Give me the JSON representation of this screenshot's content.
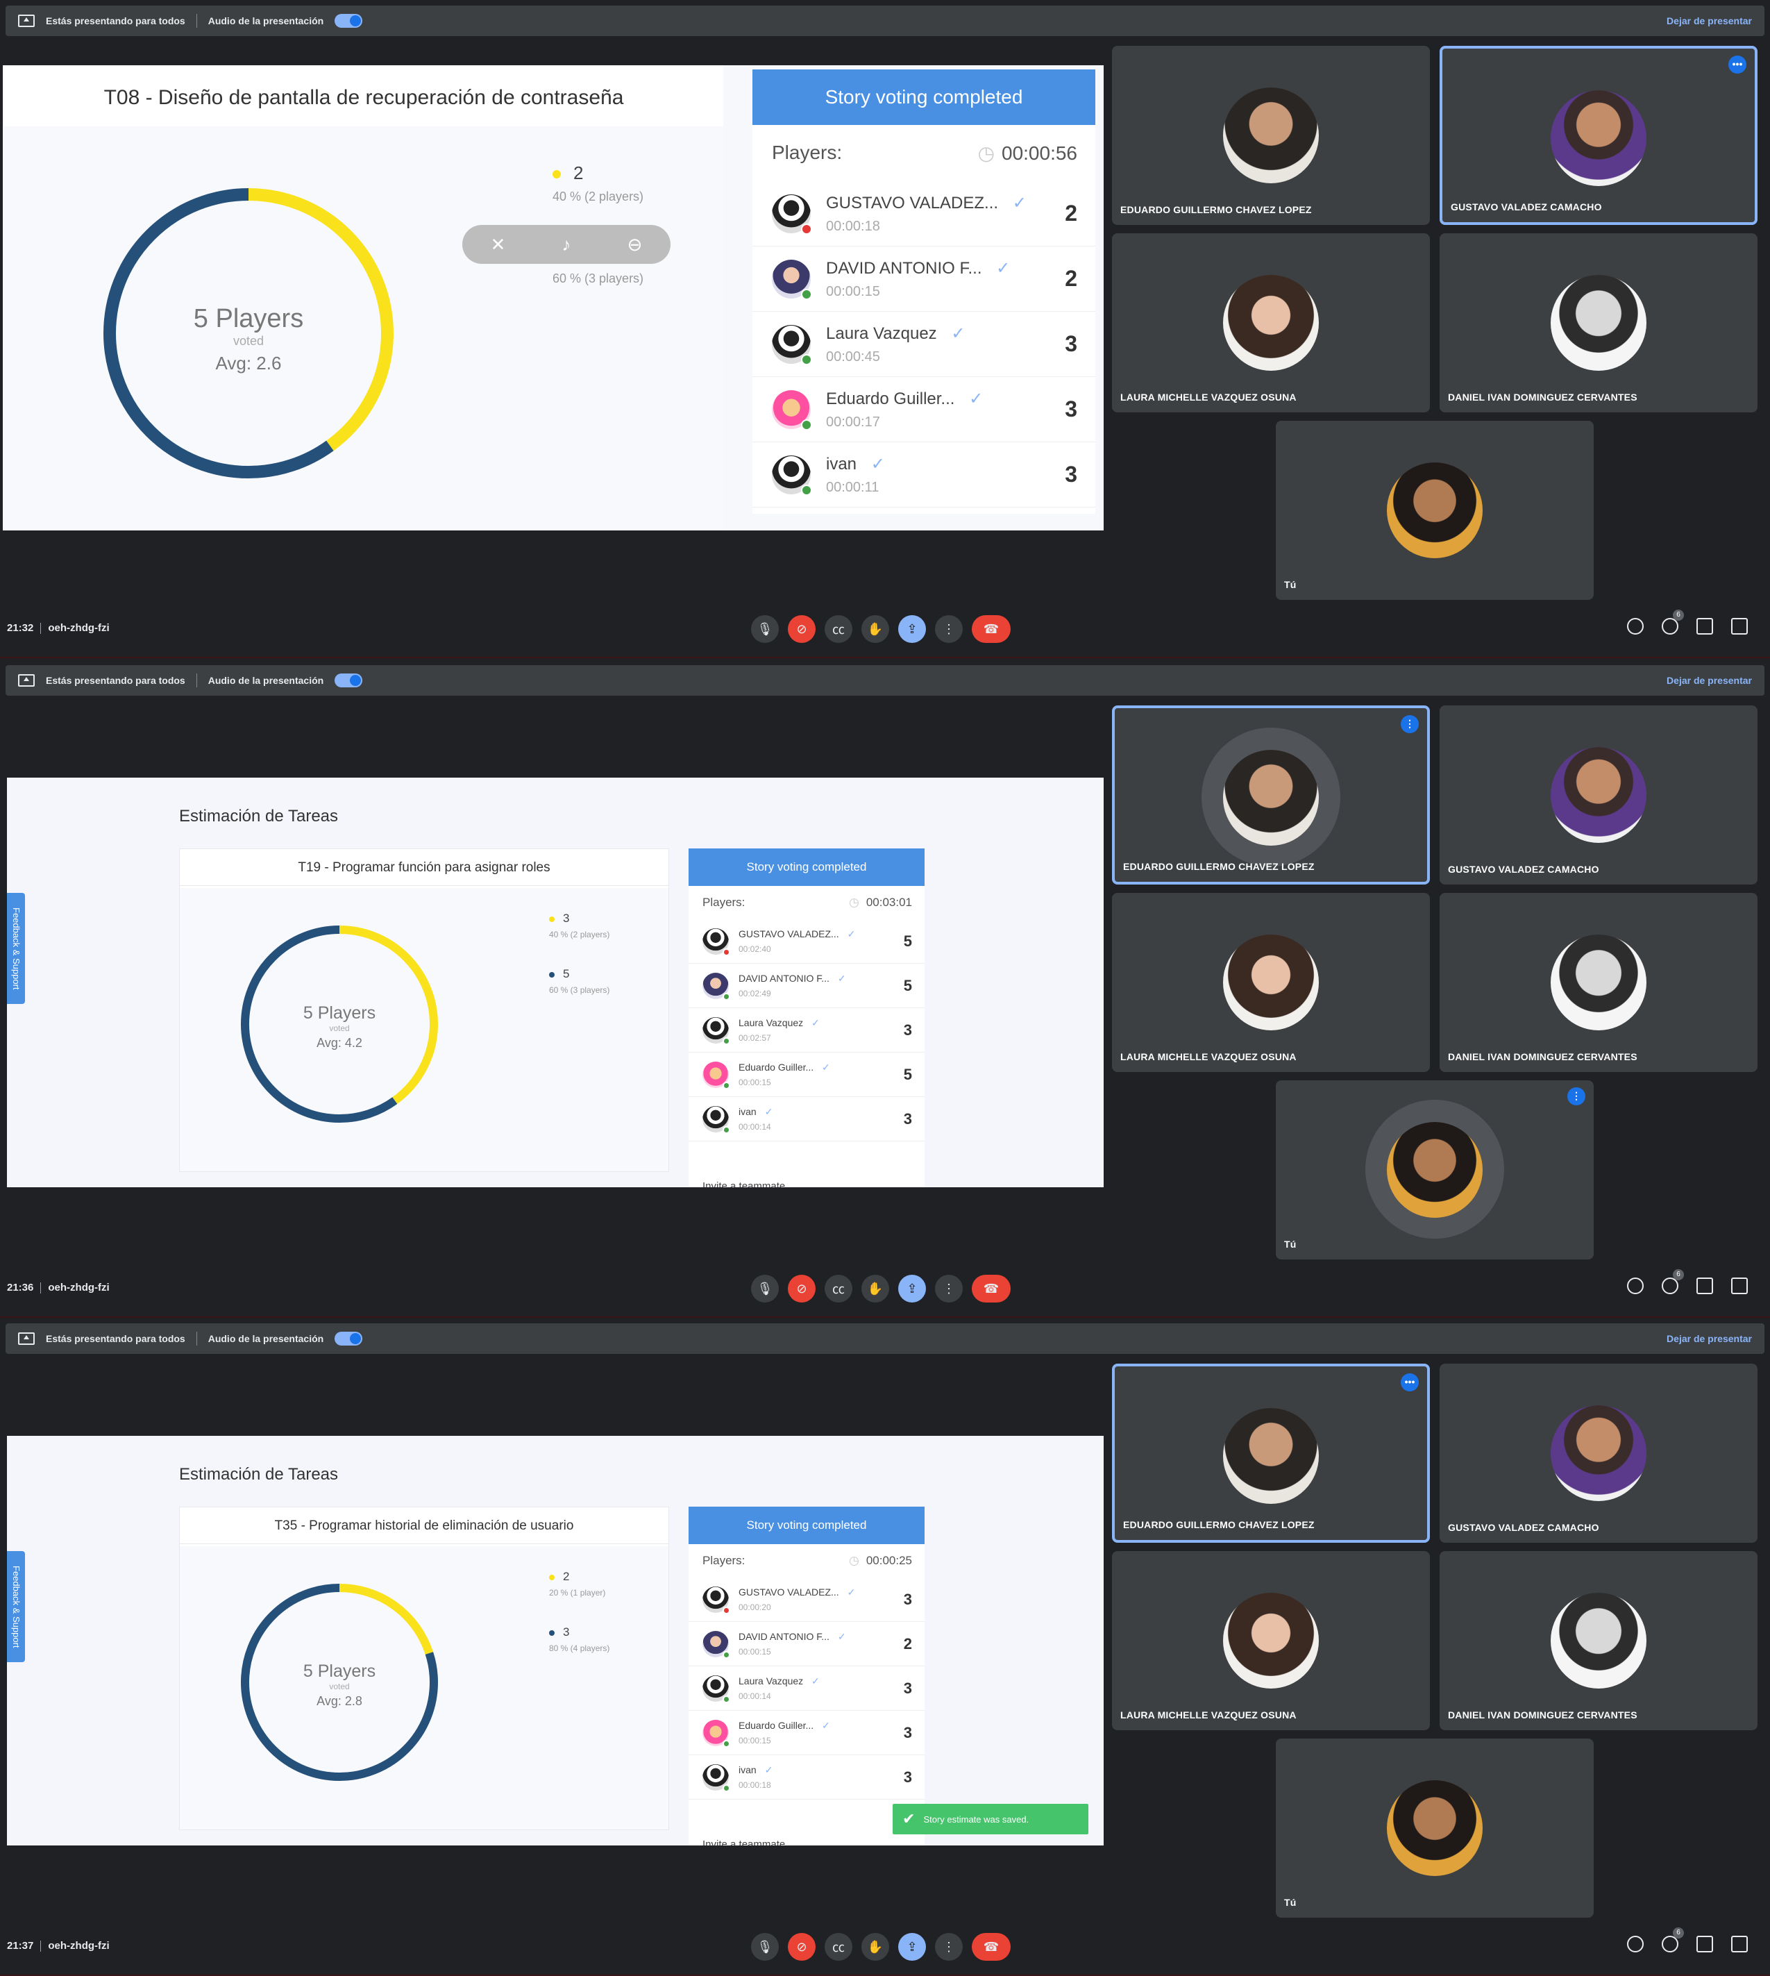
{
  "topbar": {
    "presenting_text": "Estás presentando para todos",
    "audio_text": "Audio de la presentación",
    "stop_label": "Dejar de presentar"
  },
  "participants": {
    "eduardo": "EDUARDO GUILLERMO CHAVEZ LOPEZ",
    "gustavo": "GUSTAVO VALADEZ CAMACHO",
    "laura": "LAURA MICHELLE VAZQUEZ OSUNA",
    "daniel": "DANIEL IVAN DOMINGUEZ CERVANTES",
    "me": "Tú"
  },
  "meeting_code": "oeh-zhdg-fzi",
  "people_count": "6",
  "icons": [
    "present-icon",
    "mic-icon",
    "camera-off-icon",
    "captions-icon",
    "raise-hand-icon",
    "present-now-icon",
    "more-options-icon",
    "hang-up-icon",
    "info-icon",
    "people-icon",
    "chat-icon",
    "activities-icon",
    "check-icon",
    "clock-icon",
    "mute-icon",
    "volume-icon",
    "minus-icon",
    "dots-icon",
    "speaking-icon"
  ],
  "colors": {
    "voted_yellow": "#f9e21b",
    "voted_navy": "#24507a",
    "vote_header": "#4a90e2",
    "toast_green": "#45c46b"
  },
  "frames": [
    {
      "time": "21:32",
      "page_heading": "",
      "story_title": "T08 - Diseño de pantalla de recuperación de contraseña",
      "vote_header": "Story voting completed",
      "players_label": "Players:",
      "timer": "00:00:56",
      "donut": {
        "players": "5 Players",
        "voted": "voted",
        "avg": "Avg: 2.6"
      },
      "legend": [
        {
          "value": "2",
          "pct": "40 % (2 players)"
        },
        {
          "value": "3",
          "pct": "60 % (3 players)"
        }
      ],
      "players": [
        {
          "name": "GUSTAVO VALADEZ...",
          "time": "00:00:18",
          "vote": "2"
        },
        {
          "name": "DAVID ANTONIO F...",
          "time": "00:00:15",
          "vote": "2"
        },
        {
          "name": "Laura Vazquez",
          "time": "00:00:45",
          "vote": "3"
        },
        {
          "name": "Eduardo Guiller...",
          "time": "00:00:17",
          "vote": "3"
        },
        {
          "name": "ivan",
          "time": "00:00:11",
          "vote": "3"
        }
      ],
      "invite": "",
      "toast": "",
      "feedback": ""
    },
    {
      "time": "21:36",
      "page_heading": "Estimación de Tareas",
      "story_title": "T19 - Programar función para asignar roles",
      "vote_header": "Story voting completed",
      "players_label": "Players:",
      "timer": "00:03:01",
      "donut": {
        "players": "5 Players",
        "voted": "voted",
        "avg": "Avg: 4.2"
      },
      "legend": [
        {
          "value": "3",
          "pct": "40 % (2 players)"
        },
        {
          "value": "5",
          "pct": "60 % (3 players)"
        }
      ],
      "players": [
        {
          "name": "GUSTAVO VALADEZ...",
          "time": "00:02:40",
          "vote": "5"
        },
        {
          "name": "DAVID ANTONIO F...",
          "time": "00:02:49",
          "vote": "5"
        },
        {
          "name": "Laura Vazquez",
          "time": "00:02:57",
          "vote": "3"
        },
        {
          "name": "Eduardo Guiller...",
          "time": "00:00:15",
          "vote": "5"
        },
        {
          "name": "ivan",
          "time": "00:00:14",
          "vote": "3"
        }
      ],
      "invite": "Invite a teammate",
      "toast": "",
      "feedback": "Feedback & Support"
    },
    {
      "time": "21:37",
      "page_heading": "Estimación de Tareas",
      "story_title": "T35 - Programar historial de eliminación de usuario",
      "vote_header": "Story voting completed",
      "players_label": "Players:",
      "timer": "00:00:25",
      "donut": {
        "players": "5 Players",
        "voted": "voted",
        "avg": "Avg: 2.8"
      },
      "legend": [
        {
          "value": "2",
          "pct": "20 % (1 player)"
        },
        {
          "value": "3",
          "pct": "80 % (4 players)"
        }
      ],
      "players": [
        {
          "name": "GUSTAVO VALADEZ...",
          "time": "00:00:20",
          "vote": "3"
        },
        {
          "name": "DAVID ANTONIO F...",
          "time": "00:00:15",
          "vote": "2"
        },
        {
          "name": "Laura Vazquez",
          "time": "00:00:14",
          "vote": "3"
        },
        {
          "name": "Eduardo Guiller...",
          "time": "00:00:15",
          "vote": "3"
        },
        {
          "name": "ivan",
          "time": "00:00:18",
          "vote": "3"
        }
      ],
      "invite": "Invite a teammate",
      "toast": "Story estimate was saved.",
      "feedback": "Feedback & Support"
    }
  ],
  "chart_data": [
    {
      "type": "pie",
      "categories": [
        "2",
        "3"
      ],
      "values": [
        40,
        60
      ],
      "title": "T08 - Diseño de pantalla de recuperación de contraseña"
    },
    {
      "type": "pie",
      "categories": [
        "3",
        "5"
      ],
      "values": [
        40,
        60
      ],
      "title": "T19 - Programar función para asignar roles"
    },
    {
      "type": "pie",
      "categories": [
        "2",
        "3"
      ],
      "values": [
        20,
        80
      ],
      "title": "T35 - Programar historial de eliminación de usuario"
    }
  ]
}
